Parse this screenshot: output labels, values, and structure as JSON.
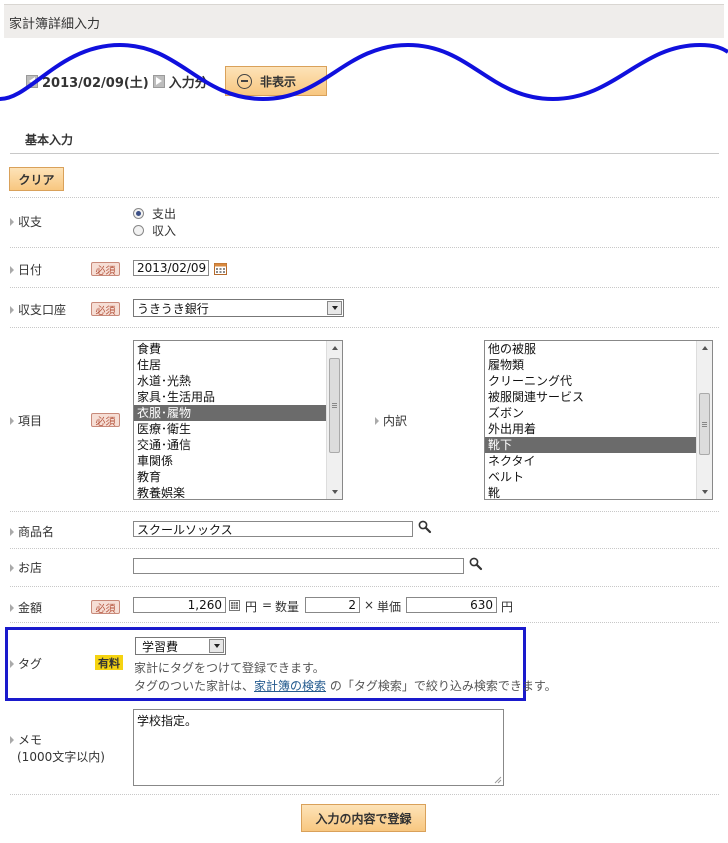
{
  "page": {
    "title": "家計簿詳細入力"
  },
  "date_nav": {
    "date": "2013/02/09(土)",
    "suffix": "入力分",
    "hide_label": "非表示"
  },
  "section": {
    "title": "基本入力",
    "clear_label": "クリア"
  },
  "form": {
    "required_badge": "必須",
    "paid_badge": "有料",
    "type": {
      "label": "収支",
      "options": [
        {
          "label": "支出",
          "checked": true
        },
        {
          "label": "収入",
          "checked": false
        }
      ]
    },
    "date": {
      "label": "日付",
      "value": "2013/02/09"
    },
    "account": {
      "label": "収支口座",
      "value": "うきうき銀行"
    },
    "category": {
      "label": "項目",
      "items": [
        "食費",
        "住居",
        "水道･光熱",
        "家具･生活用品",
        "衣服･履物",
        "医療･衛生",
        "交通･通信",
        "車関係",
        "教育",
        "教養娯楽"
      ],
      "selected": "衣服･履物"
    },
    "subcategory": {
      "label": "内訳",
      "items": [
        "他の被服",
        "履物類",
        "クリーニング代",
        "被服関連サービス",
        "ズボン",
        "外出用着",
        "靴下",
        "ネクタイ",
        "ベルト",
        "靴"
      ],
      "selected": "靴下"
    },
    "product": {
      "label": "商品名",
      "value": "スクールソックス"
    },
    "shop": {
      "label": "お店",
      "value": ""
    },
    "amount": {
      "label": "金額",
      "total": "1,260",
      "yen": "円",
      "eq": "=",
      "qty_label": "数量",
      "qty": "2",
      "times": "×",
      "unit_label": "単価",
      "unit_price": "630",
      "yen2": "円"
    },
    "tag": {
      "label": "タグ",
      "value": "学習費",
      "help1": "家計にタグをつけて登録できます。",
      "help2_pre": "タグのついた家計は、",
      "help2_link": "家計簿の検索",
      "help2_post": " の「タグ検索」で絞り込み検索できます。"
    },
    "memo": {
      "label": "メモ",
      "sub": "(1000文字以内)",
      "value": "学校指定。"
    },
    "submit_label": "入力の内容で登録"
  },
  "colors": {
    "accent_button": "#f8c780",
    "selected_item": "#6b6b6b",
    "highlight_box": "#1a1acc",
    "annotation_wave": "#1010dd",
    "required_badge": "#b4533c",
    "paid_badge": "#f5d311",
    "link": "#245b8f"
  }
}
